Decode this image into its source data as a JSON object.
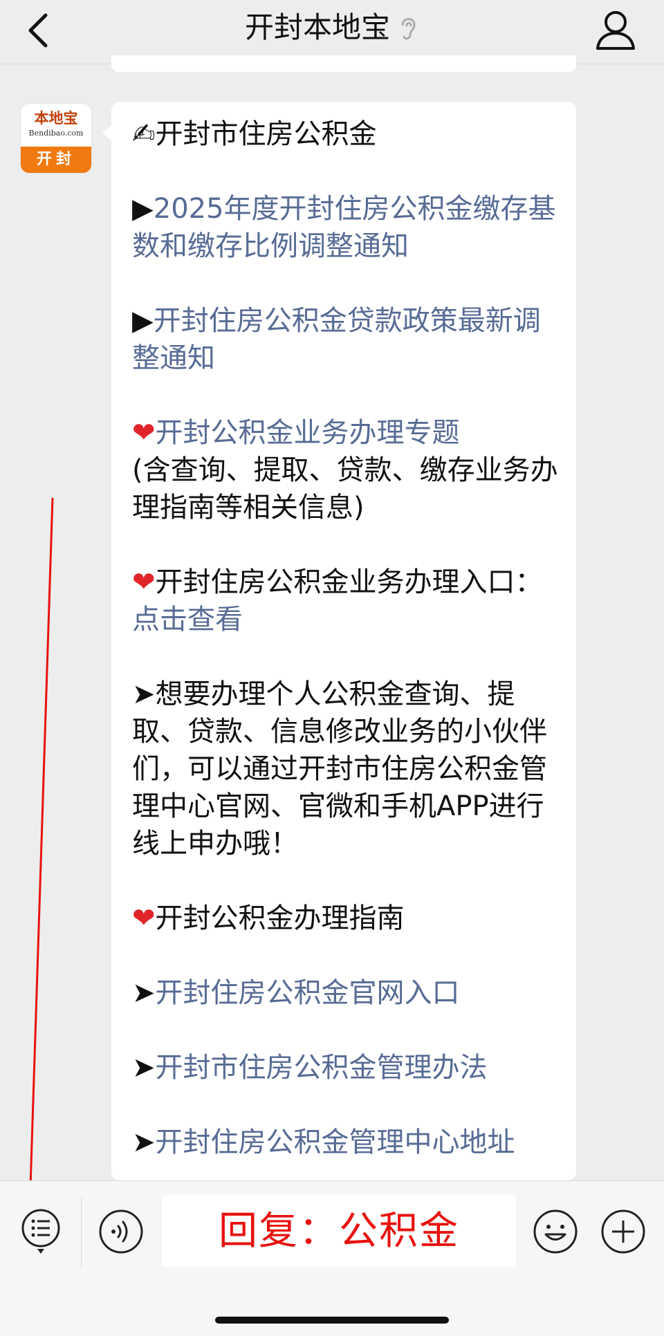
{
  "header": {
    "title": "开封本地宝"
  },
  "avatar": {
    "brand": "本地宝",
    "domain": "Bendibao.com",
    "city": "开封"
  },
  "message": {
    "heading_emoji": "✍",
    "heading": "开封市住房公积金",
    "item1_marker": "▶",
    "item1_link": "2025年度开封住房公积金缴存基数和缴存比例调整通知",
    "item2_marker": "▶",
    "item2_link": "开封住房公积金贷款政策最新调整通知",
    "item3_emoji": "❤",
    "item3_link": "开封公积金业务办理专题",
    "item3_note": "(含查询、提取、贷款、缴存业务办理指南等相关信息)",
    "item4_emoji": "❤",
    "item4_text": "开封住房公积金业务办理入口：",
    "item4_link": "点击查看",
    "item5_marker": "➤",
    "item5_text": "想要办理个人公积金查询、提取、贷款、信息修改业务的小伙伴们，可以通过开封市住房公积金管理中心官网、官微和手机APP进行线上申办哦！",
    "item6_emoji": "❤",
    "item6_text": "开封公积金办理指南",
    "item7_marker": "➤",
    "item7_link": "开封住房公积金官网入口",
    "item8_marker": "➤",
    "item8_link": "开封市住房公积金管理办法",
    "item9_marker": "➤",
    "item9_link": "开封住房公积金管理中心地址"
  },
  "input": {
    "reply_hint": "回复：公积金"
  },
  "colors": {
    "link": "#576b95",
    "annotation_red": "#e8110e",
    "background": "#ededed",
    "bubble": "#ffffff"
  },
  "icons": {
    "back": "chevron-left-icon",
    "ear": "ear-icon",
    "profile": "user-profile-icon",
    "menu": "menu-list-icon",
    "voice": "voice-icon",
    "emoji": "smiley-icon",
    "plus": "plus-icon"
  }
}
